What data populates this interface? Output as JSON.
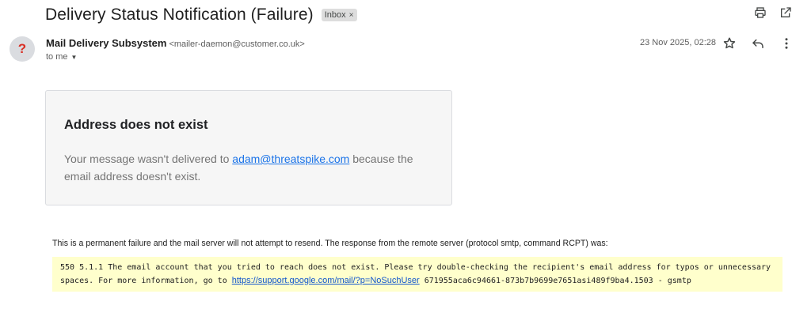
{
  "email": {
    "subject": "Delivery Status Notification (Failure)",
    "label": "Inbox",
    "label_remove_glyph": "×",
    "sender_name": "Mail Delivery Subsystem",
    "sender_email": "<mailer-daemon@customer.co.uk>",
    "avatar_glyph": "?",
    "to": "to me",
    "date": "23 Nov 2025, 02:28"
  },
  "toolbar": {
    "icons": [
      "print-icon",
      "open-in-new-window-icon"
    ]
  },
  "actions": {
    "icons": [
      "star-icon",
      "reply-icon",
      "more-vertical-icon"
    ]
  },
  "card": {
    "title": "Address does not exist",
    "body_prefix": "Your message wasn't delivered to ",
    "recipient_link": "adam@threatspike.com",
    "body_suffix": " because the email address doesn't exist."
  },
  "details": {
    "permanent_notice": "This is a permanent failure and the mail server will not attempt to resend. The response from the remote server (protocol smtp, command RCPT) was:",
    "smtp_prefix": "550 5.1.1 The email account that you tried to reach does not exist. Please try double-checking the recipient's email address for typos or unnecessary spaces. For more information, go to ",
    "smtp_link": "https://support.google.com/mail/?p=NoSuchUser",
    "smtp_suffix": " 671955aca6c94661-873b7b9699e7651asi489f9ba4.1503 - gsmtp"
  },
  "colors": {
    "avatar_question": "#d93025",
    "link": "#1a73e8",
    "smtp_background": "#ffffcc"
  }
}
